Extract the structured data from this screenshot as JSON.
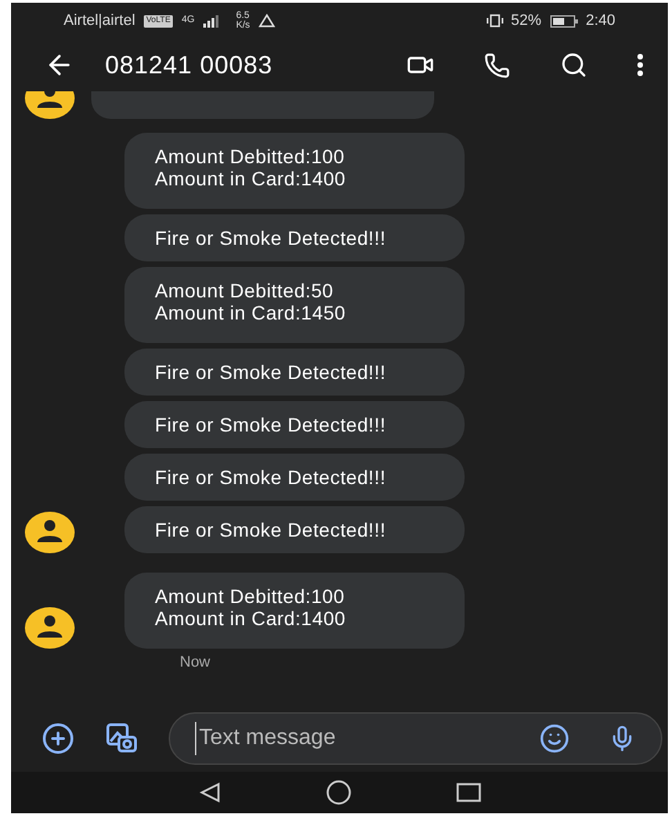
{
  "status_bar": {
    "carrier": "Airtel|airtel",
    "network_badge": "VoLTE",
    "network_type": "4G",
    "speed": "6.5",
    "speed_unit": "K/s",
    "battery": "52%",
    "time": "2:40"
  },
  "header": {
    "title": "081241 00083"
  },
  "messages": [
    {
      "lines": [
        "Amount Debitted:100",
        "Amount in Card:1400"
      ],
      "avatar": false
    },
    {
      "lines": [
        "Fire or Smoke Detected!!!"
      ],
      "avatar": false
    },
    {
      "lines": [
        "Amount Debitted:50",
        "Amount in Card:1450"
      ],
      "avatar": false
    },
    {
      "lines": [
        "Fire or Smoke Detected!!!"
      ],
      "avatar": false
    },
    {
      "lines": [
        "Fire or Smoke Detected!!!"
      ],
      "avatar": false
    },
    {
      "lines": [
        "Fire or Smoke Detected!!!"
      ],
      "avatar": false
    },
    {
      "lines": [
        "Fire or Smoke Detected!!!"
      ],
      "avatar": true
    },
    {
      "lines": [
        "Amount Debitted:100",
        "Amount in Card:1400"
      ],
      "avatar": true
    }
  ],
  "timestamp": "Now",
  "composer": {
    "placeholder": "Text message"
  }
}
